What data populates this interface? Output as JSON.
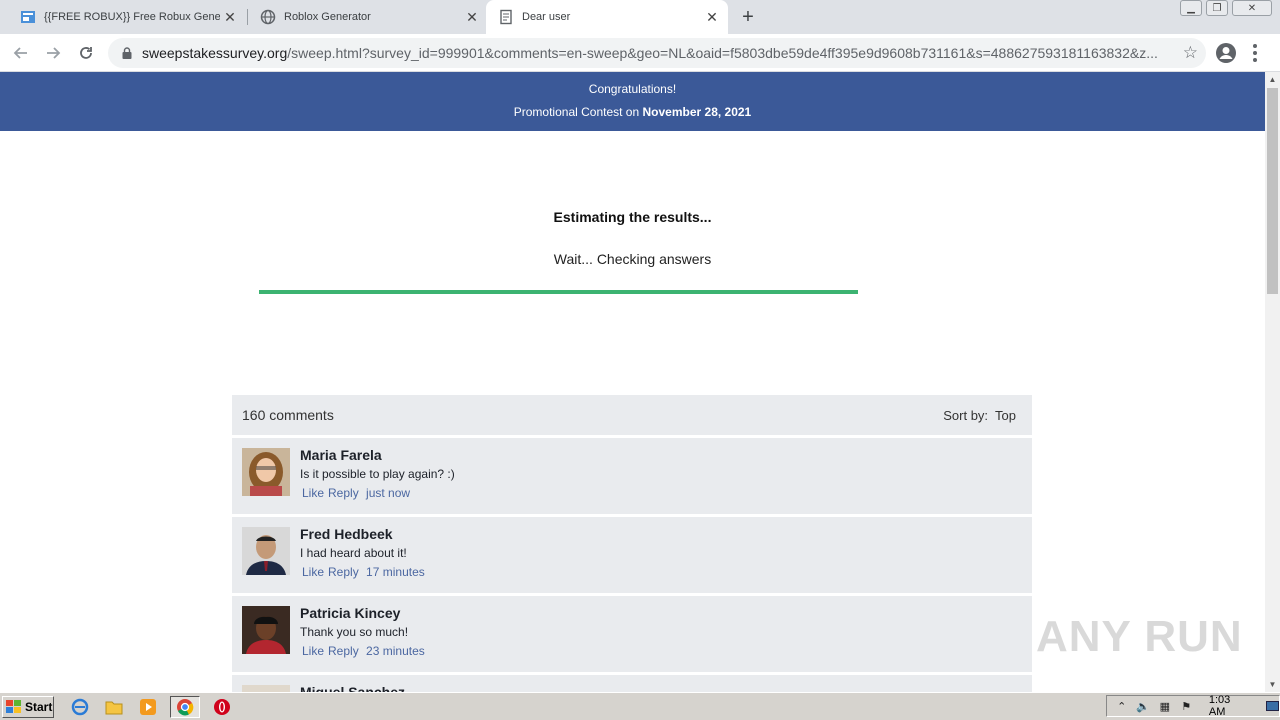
{
  "browser": {
    "tabs": [
      {
        "title": "{{FREE ROBUX}} Free Robux Gener",
        "icon": "page-icon",
        "active": false
      },
      {
        "title": "Roblox Generator",
        "icon": "globe-icon",
        "active": false
      },
      {
        "title": "Dear user",
        "icon": "document-icon",
        "active": true
      }
    ],
    "new_tab_label": "+",
    "url_domain": "sweepstakessurvey.org",
    "url_rest": "/sweep.html?survey_id=999901&comments=en-sweep&geo=NL&oaid=f5803dbe59de4ff395e9d9608b731161&s=488627593181163832&z..."
  },
  "page": {
    "banner_line1": "Congratulations!",
    "banner_line2_prefix": "Promotional Contest on ",
    "banner_date": "November 28, 2021",
    "estimating": "Estimating the results...",
    "wait_text": "Wait... Checking answers",
    "progress_fraction": 1.0,
    "accent_color": "#3b5998",
    "progress_color": "#3cb371"
  },
  "comments": {
    "count_label": "160 comments",
    "sort_label": "Sort by:",
    "sort_value": "Top",
    "items": [
      {
        "name": "Maria Farela",
        "text": "Is it possible to play again? :)",
        "like": "Like",
        "reply": "Reply",
        "time": "just now"
      },
      {
        "name": "Fred Hedbeek",
        "text": "I had heard about it!",
        "like": "Like",
        "reply": "Reply",
        "time": "17 minutes"
      },
      {
        "name": "Patricia Kincey",
        "text": "Thank you so much!",
        "like": "Like",
        "reply": "Reply",
        "time": "23 minutes"
      },
      {
        "name": "Miguel Sanchez",
        "text": "",
        "like": "",
        "reply": "",
        "time": ""
      }
    ]
  },
  "watermark": "ANY RUN",
  "taskbar": {
    "start_label": "Start",
    "clock": "1:03 AM"
  }
}
